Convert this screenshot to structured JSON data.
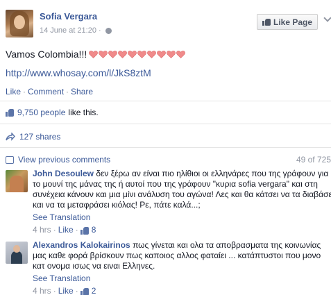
{
  "post": {
    "author": "Sofia Vergara",
    "timestamp": "14 June at 21:20 ·",
    "like_page_label": "Like Page",
    "text": "Vamos Colombia!!!",
    "heart_count_visible": 10,
    "heart_color": "#f08a8a",
    "link": "http://www.whosay.com/l/JkS8ztM",
    "actions": [
      "Like",
      "Comment",
      "Share"
    ]
  },
  "stats": {
    "likes_count": "9,750 people",
    "likes_suffix": "like this.",
    "shares": "127 shares"
  },
  "comments_section": {
    "view_previous": "View previous comments",
    "count": "49 of 725"
  },
  "comments": [
    {
      "author": "John Desoulew",
      "lines": [
        "δεν ξέρω αν είναι πιο ηλίθιοι οι ελληνάρες που της γράφουν για",
        "το μουνί της μάνας της ή αυτοί που της γράφουν \"κυρια sofia vergara\" και στη",
        "συνέχεια κάνουν και μια μίνι ανάλυση του αγώνα! Λες και θα κάτσει να τα διαβάσει",
        "και να τα μεταφράσει κιόλας! Ρε, πάτε καλά...;"
      ],
      "see_translation": "See Translation",
      "time": "4 hrs",
      "like_label": "Like",
      "likes": "8"
    },
    {
      "author": "Alexandros Kalokairinos",
      "lines": [
        "πως γίνεται και ολα τα αποβρασματα της κοινωνίας",
        "μας καθε φορά βρίσκουν πως καποιος αλλος φαταίει ... κατάπτυστοι που μονο",
        "κατ ονομα ισως να ειναι Ελληνες."
      ],
      "see_translation": "See Translation",
      "time": "4 hrs",
      "like_label": "Like",
      "likes": "2"
    }
  ],
  "colors": {
    "link": "#3b5998",
    "meta": "#9197a3",
    "text": "#141823"
  }
}
